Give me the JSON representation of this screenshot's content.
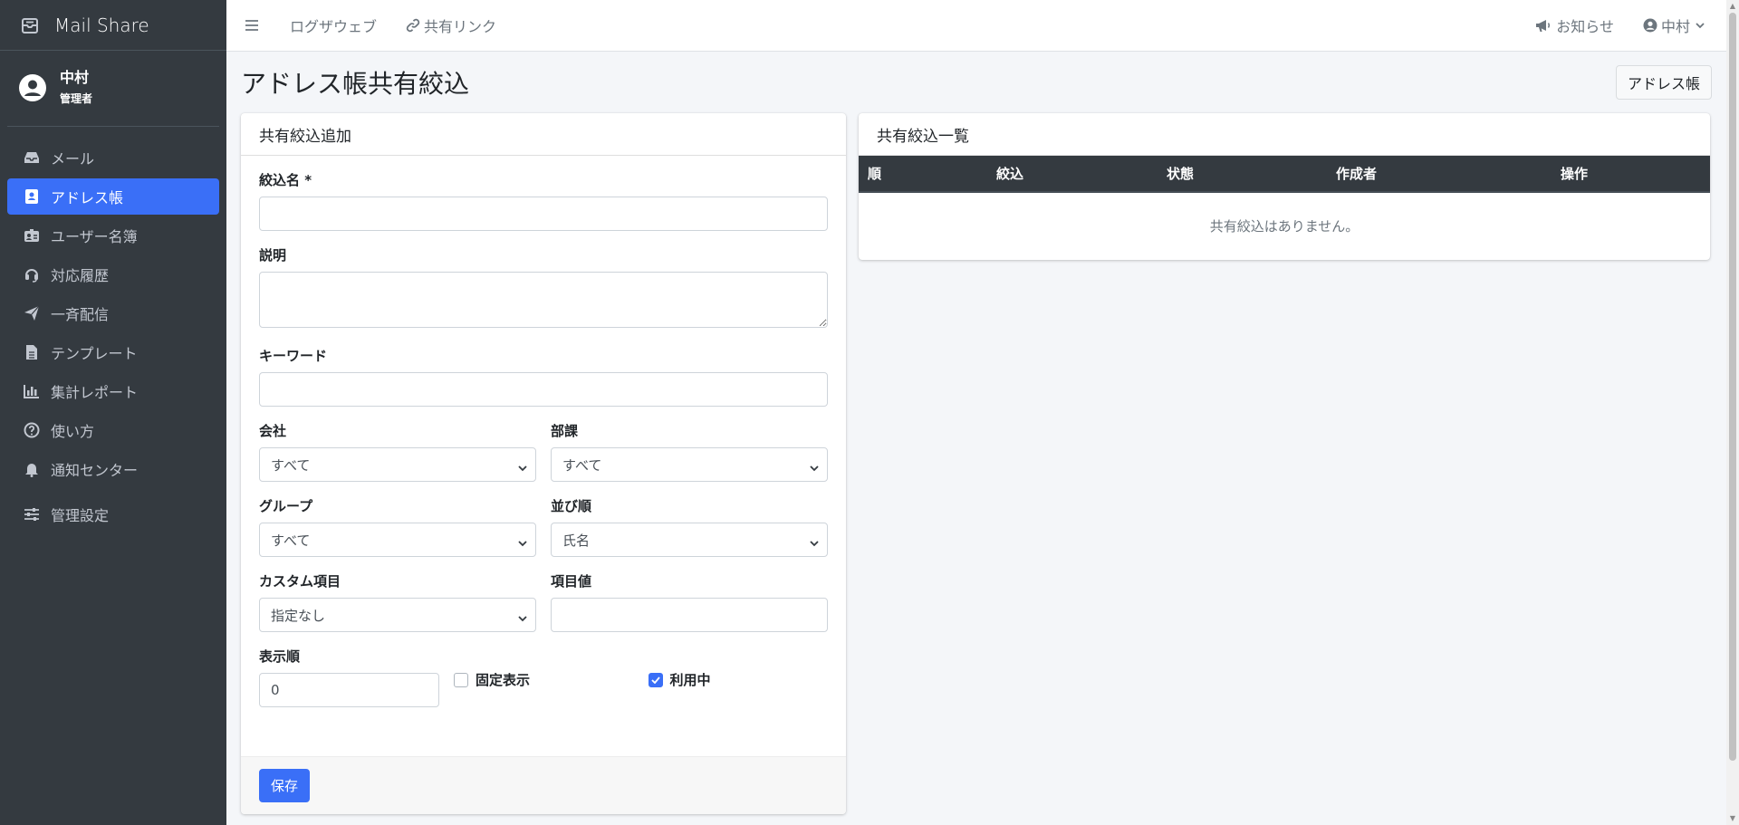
{
  "brand": {
    "name": "Mail Share",
    "icon": "mail-box-icon"
  },
  "user": {
    "name": "中村",
    "role": "管理者"
  },
  "sidebar": {
    "items": [
      {
        "label": "メール",
        "icon": "inbox-icon"
      },
      {
        "label": "アドレス帳",
        "icon": "address-book-icon",
        "active": true
      },
      {
        "label": "ユーザー名簿",
        "icon": "id-card-icon"
      },
      {
        "label": "対応履歴",
        "icon": "headset-icon"
      },
      {
        "label": "一斉配信",
        "icon": "paper-plane-icon"
      },
      {
        "label": "テンプレート",
        "icon": "file-icon"
      },
      {
        "label": "集計レポート",
        "icon": "bar-chart-icon"
      },
      {
        "label": "使い方",
        "icon": "question-circle-icon"
      },
      {
        "label": "通知センター",
        "icon": "bell-icon"
      },
      {
        "label": "管理設定",
        "icon": "sliders-icon"
      }
    ]
  },
  "topbar": {
    "links": [
      {
        "label": "ログザウェブ"
      },
      {
        "label": "共有リンク",
        "icon": "link-icon"
      }
    ],
    "notice": "お知らせ",
    "user_menu": "中村"
  },
  "page": {
    "title": "アドレス帳共有絞込",
    "address_book_button": "アドレス帳"
  },
  "form": {
    "header": "共有絞込追加",
    "name_label": "絞込名 *",
    "name_value": "",
    "description_label": "説明",
    "description_value": "",
    "keyword_label": "キーワード",
    "keyword_value": "",
    "company_label": "会社",
    "company_value": "すべて",
    "department_label": "部課",
    "department_value": "すべて",
    "group_label": "グループ",
    "group_value": "すべて",
    "sort_label": "並び順",
    "sort_value": "氏名",
    "custom_label": "カスタム項目",
    "custom_value": "指定なし",
    "item_value_label": "項目値",
    "item_value": "",
    "order_label": "表示順",
    "order_value": "0",
    "fixed_label": "固定表示",
    "fixed_checked": false,
    "active_label": "利用中",
    "active_checked": true,
    "save_label": "保存"
  },
  "list": {
    "header": "共有絞込一覧",
    "columns": [
      "順",
      "絞込",
      "状態",
      "作成者",
      "操作"
    ],
    "empty_message": "共有絞込はありません。"
  },
  "colors": {
    "sidebar": "#343a40",
    "accent": "#3a6ff7"
  }
}
